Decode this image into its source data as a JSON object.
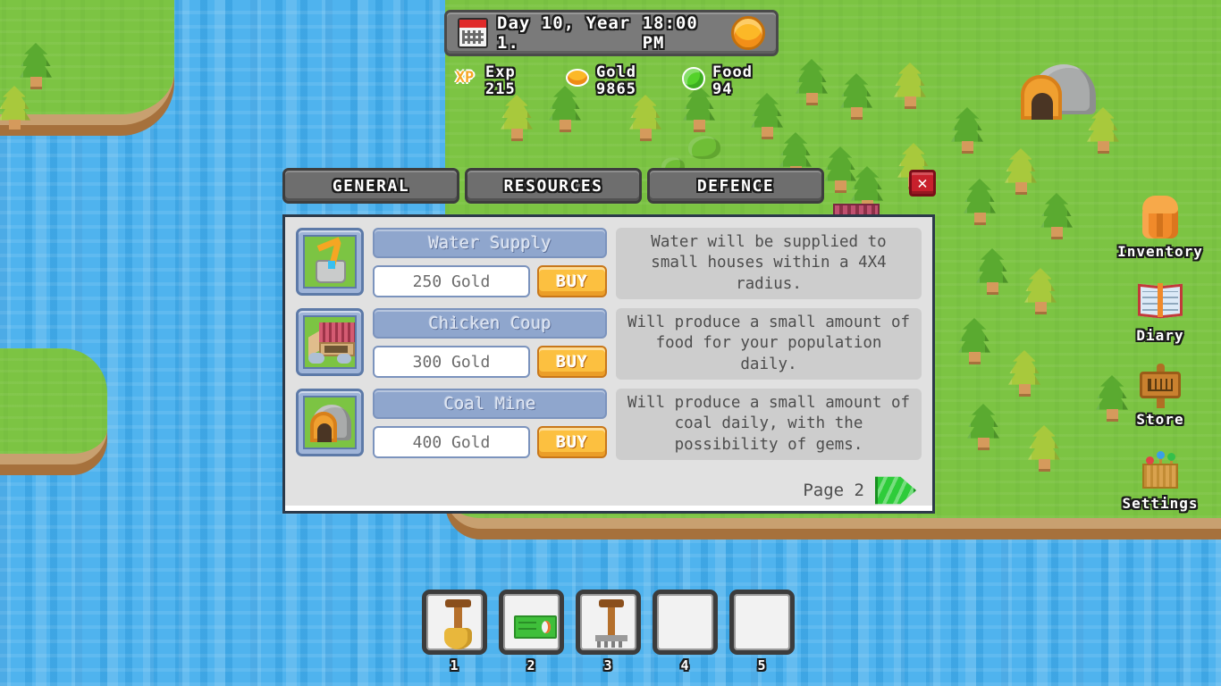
{
  "hud": {
    "clock": {
      "calendar_icon": "calendar-icon",
      "date_text": "Day 10, Year 1.",
      "time_text": "18:00 PM",
      "sun_icon": "sun-icon"
    },
    "resources": [
      {
        "icon": "xp-icon",
        "name": "Exp",
        "value": "215"
      },
      {
        "icon": "gold-icon",
        "name": "Gold",
        "value": "9865"
      },
      {
        "icon": "food-icon",
        "name": "Food",
        "value": "94"
      }
    ]
  },
  "shop": {
    "tabs": [
      {
        "label": "GENERAL"
      },
      {
        "label": "RESOURCES"
      },
      {
        "label": "DEFENCE"
      }
    ],
    "close_label": "✕",
    "items": [
      {
        "icon": "water-supply-icon",
        "name": "Water Supply",
        "price": "250 Gold",
        "buy_label": "BUY",
        "description": "Water will be supplied to small houses within a 4X4 radius."
      },
      {
        "icon": "chicken-coup-icon",
        "name": "Chicken Coup",
        "price": "300 Gold",
        "buy_label": "BUY",
        "description": "Will produce a small amount of food for your population daily."
      },
      {
        "icon": "coal-mine-icon",
        "name": "Coal Mine",
        "price": "400 Gold",
        "buy_label": "BUY",
        "description": "Will produce a small amount of coal daily, with the possibility of gems."
      }
    ],
    "page_label": "Page 2",
    "next_page_icon": "next-page-arrow-icon"
  },
  "sidebar": [
    {
      "icon": "backpack-icon",
      "label": "Inventory"
    },
    {
      "icon": "book-icon",
      "label": "Diary"
    },
    {
      "icon": "store-sign-icon",
      "label": "Store"
    },
    {
      "icon": "basket-icon",
      "label": "Settings"
    }
  ],
  "hotbar": [
    {
      "slot": "1",
      "icon": "shovel-icon"
    },
    {
      "slot": "2",
      "icon": "seed-packet-icon"
    },
    {
      "slot": "3",
      "icon": "rake-icon"
    },
    {
      "slot": "4",
      "icon": "empty-slot"
    },
    {
      "slot": "5",
      "icon": "empty-slot"
    }
  ],
  "colors": {
    "water": "#4fb3ee",
    "grass": "#7cc443",
    "sand": "#c8a070",
    "panel_bg": "#e1e1e1",
    "tab_gray": "#6e6e6e",
    "accent_gold": "#fcc040",
    "item_header_blue": "#8fa6cd",
    "close_red": "#c8202c",
    "next_green": "#2ecc3a"
  }
}
